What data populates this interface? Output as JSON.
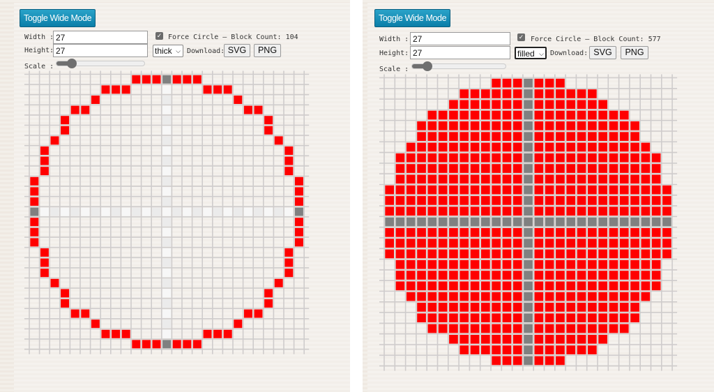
{
  "panels": [
    {
      "toggle_label": "Toggle Wide Mode",
      "width_label": "Width :",
      "width_value": "27",
      "height_label": "Height:",
      "height_value": "27",
      "force_circle_checked": true,
      "force_circle_text": "Force Circle — Block Count: 104",
      "mode_select": "thick",
      "download_label": "Download:",
      "svg_button": "SVG",
      "png_button": "PNG",
      "scale_label": "Scale :",
      "scale_value_fraction": 0.12,
      "grid": {
        "cols": 27,
        "rows": 27,
        "mode": "thick",
        "block_count": 104
      }
    },
    {
      "toggle_label": "Toggle Wide Mode",
      "width_label": "Width :",
      "width_value": "27",
      "height_label": "Height:",
      "height_value": "27",
      "force_circle_checked": true,
      "force_circle_text": "Force Circle — Block Count: 577",
      "mode_select": "filled",
      "download_label": "Download:",
      "svg_button": "SVG",
      "png_button": "PNG",
      "scale_label": "Scale :",
      "scale_value_fraction": 0.12,
      "grid": {
        "cols": 27,
        "rows": 27,
        "mode": "filled",
        "block_count": 577
      }
    }
  ],
  "colors": {
    "block": "#ff0000",
    "axis_block": "#808080",
    "axis_light_a": "#f7f7f7",
    "axis_light_b": "#ebebeb",
    "grid_line": "#cfcccc",
    "button_accent": "#1591bb"
  },
  "circle_half_widths_outer": [
    3,
    6,
    7,
    9,
    10,
    10,
    11,
    12,
    12,
    12,
    13,
    13,
    13,
    13
  ]
}
